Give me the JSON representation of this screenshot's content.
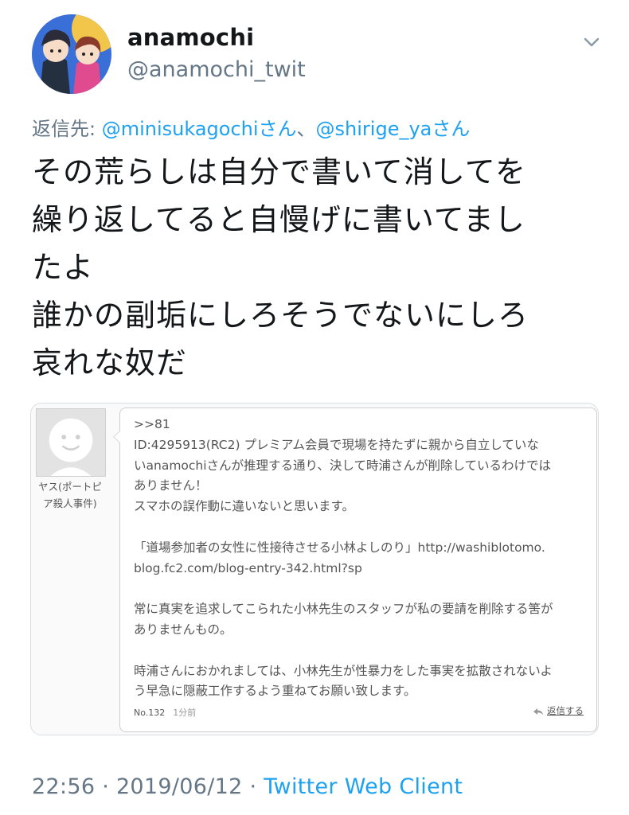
{
  "tweet": {
    "display_name": "anamochi",
    "handle": "@anamochi_twit",
    "reply_prefix": "返信先: ",
    "reply_mentions": [
      "@minisukagochiさん",
      "@shirige_yaさん"
    ],
    "reply_separator": "、",
    "text_lines": [
      "その荒らしは自分で書いて消してを",
      "繰り返してると自慢げに書いてまし",
      "たよ",
      "誰かの副垢にしろそうでないにしろ",
      "哀れな奴だ"
    ],
    "timestamp": "22:56 · 2019/06/12 · ",
    "client": "Twitter Web Client"
  },
  "embedded_post": {
    "poster_name_lines": [
      "ヤス(ポートピ",
      "ア殺人事件)"
    ],
    "body_lines": [
      ">>81",
      "ID:4295913(RC2) プレミアム会員で現場を持たずに親から自立していな",
      "いanamochiさんが推理する通り、決して時浦さんが削除しているわけでは",
      "ありません！",
      "スマホの誤作動に違いないと思います。",
      "",
      "「道場参加者の女性に性接待させる小林よしのり」http://washiblotomo.",
      "blog.fc2.com/blog-entry-342.html?sp",
      "",
      "常に真実を追求してこられた小林先生のスタッフが私の要請を削除する筈が",
      "ありませんもの。",
      "",
      "時浦さんにおかれましては、小林先生が性暴力をした事実を拡散されないよ",
      "う早急に隠蔽工作するよう重ねてお願い致します。"
    ],
    "post_number": "No.132",
    "post_time": "1分前",
    "reply_label": "返信する"
  },
  "icons": {
    "menu": "chevron-down-icon",
    "reply": "reply-arrow-icon",
    "default_avatar": "default-avatar-icon"
  },
  "colors": {
    "link_blue": "#1da1f2",
    "secondary_gray": "#657786",
    "text_black": "#14171a"
  }
}
